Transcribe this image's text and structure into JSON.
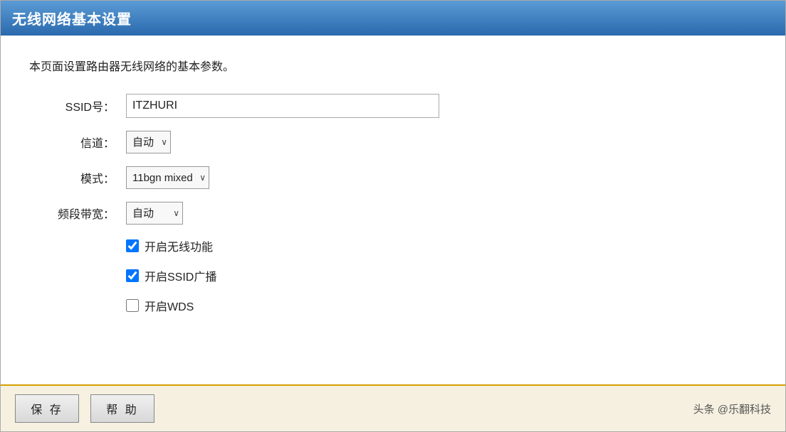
{
  "window": {
    "title": "无线网络基本设置"
  },
  "content": {
    "description": "本页面设置路由器无线网络的基本参数。"
  },
  "form": {
    "ssid_label": "SSID号：",
    "ssid_value": "ITZHURI",
    "channel_label": "信道：",
    "channel_options": [
      "自动"
    ],
    "channel_selected": "自动",
    "mode_label": "模式：",
    "mode_options": [
      "11bgn mixed"
    ],
    "mode_selected": "11bgn mixed",
    "bandwidth_label": "频段带宽：",
    "bandwidth_options": [
      "自动"
    ],
    "bandwidth_selected": "自动",
    "checkbox_wireless_label": "开启无线功能",
    "checkbox_wireless_checked": true,
    "checkbox_ssid_label": "开启SSID广播",
    "checkbox_ssid_checked": true,
    "checkbox_wds_label": "开启WDS",
    "checkbox_wds_checked": false
  },
  "footer": {
    "save_label": "保 存",
    "help_label": "帮 助",
    "watermark_text": "头条 @乐翻科技"
  }
}
